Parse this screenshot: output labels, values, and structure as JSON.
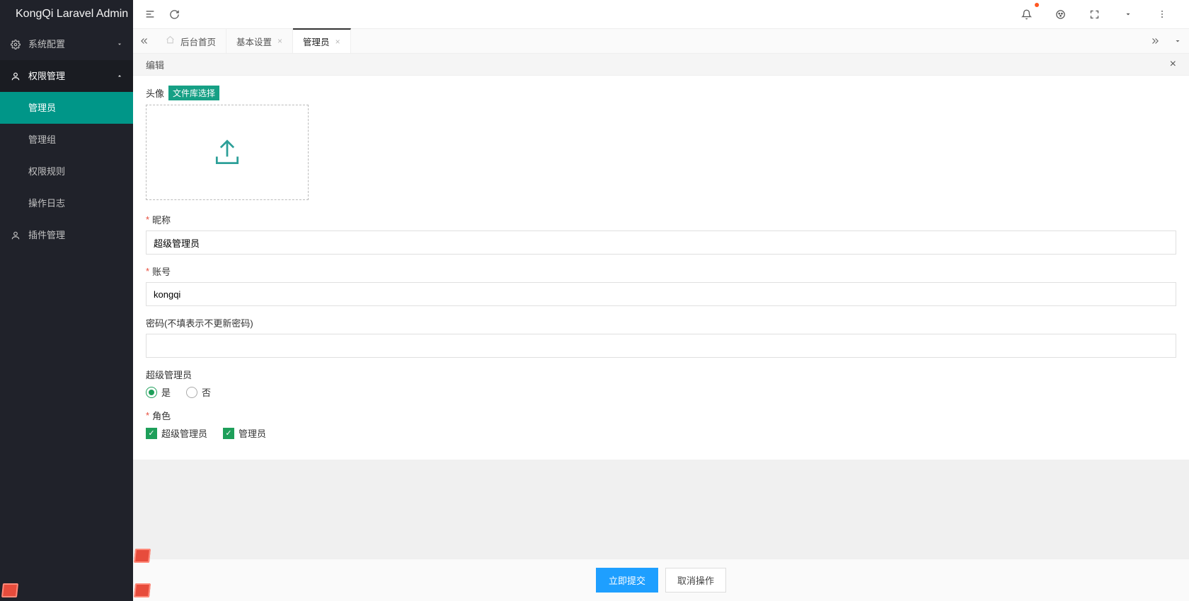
{
  "brand": "KongQi Laravel Admin",
  "sidebar": {
    "items": [
      {
        "label": "系统配置",
        "open": false
      },
      {
        "label": "权限管理",
        "open": true,
        "children": [
          {
            "label": "管理员",
            "active": true
          },
          {
            "label": "管理组"
          },
          {
            "label": "权限规则"
          },
          {
            "label": "操作日志"
          }
        ]
      },
      {
        "label": "插件管理"
      }
    ]
  },
  "tabs": {
    "home": "后台首页",
    "items": [
      {
        "label": "基本设置",
        "active": false
      },
      {
        "label": "管理员",
        "active": true
      }
    ]
  },
  "panel": {
    "title": "编辑"
  },
  "form": {
    "avatar_label": "头像",
    "file_picker_btn": "文件库选择",
    "nickname_label": "昵称",
    "nickname_value": "超级管理员",
    "account_label": "账号",
    "account_value": "kongqi",
    "password_label": "密码(不填表示不更新密码)",
    "password_value": "",
    "superadmin_label": "超级管理员",
    "superadmin_options": {
      "yes": "是",
      "no": "否"
    },
    "superadmin_selected": "yes",
    "role_label": "角色",
    "roles": [
      {
        "label": "超级管理员",
        "checked": true
      },
      {
        "label": "管理员",
        "checked": true
      }
    ]
  },
  "footer": {
    "submit": "立即提交",
    "cancel": "取消操作"
  }
}
